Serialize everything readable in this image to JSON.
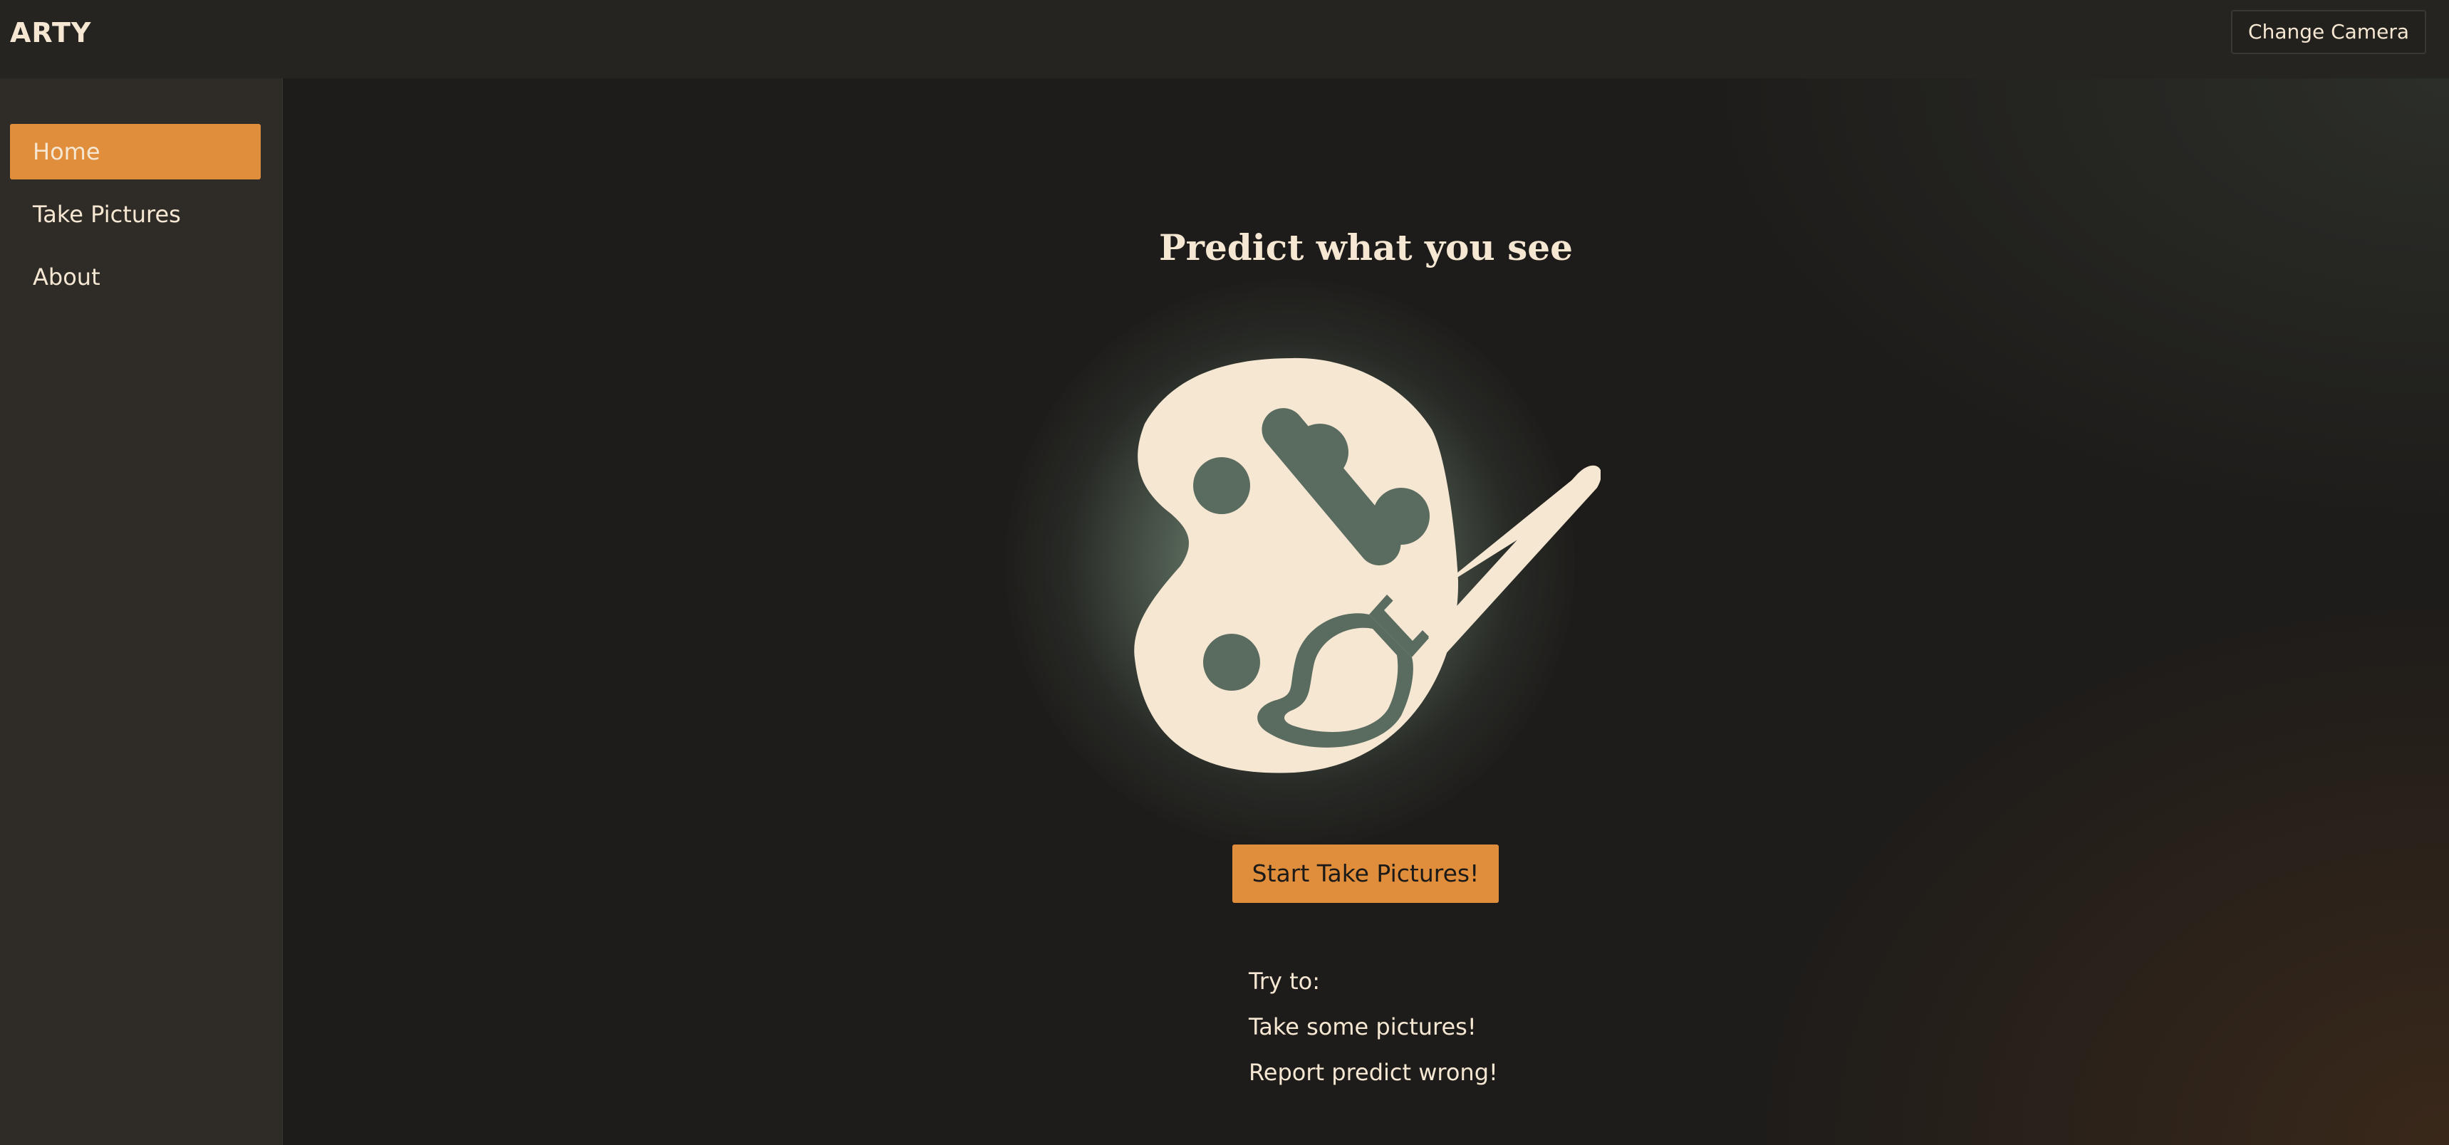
{
  "app": {
    "brand": "ARTY"
  },
  "header": {
    "change_camera_label": "Change Camera"
  },
  "sidebar": {
    "items": [
      {
        "label": "Home",
        "active": true
      },
      {
        "label": "Take Pictures",
        "active": false
      },
      {
        "label": "About",
        "active": false
      }
    ]
  },
  "main": {
    "title": "Predict what you see",
    "illustration_icon": "palette-brush-icon",
    "start_button_label": "Start Take Pictures!",
    "tips": [
      "Try to:",
      "Take some pictures!",
      "Report predict wrong!"
    ]
  },
  "colors": {
    "accent": "#e08e3b",
    "text": "#f6e7d3",
    "icon_dark": "#5a6b60",
    "background": "#1e1c1a",
    "sidebar": "#2f2c28"
  }
}
